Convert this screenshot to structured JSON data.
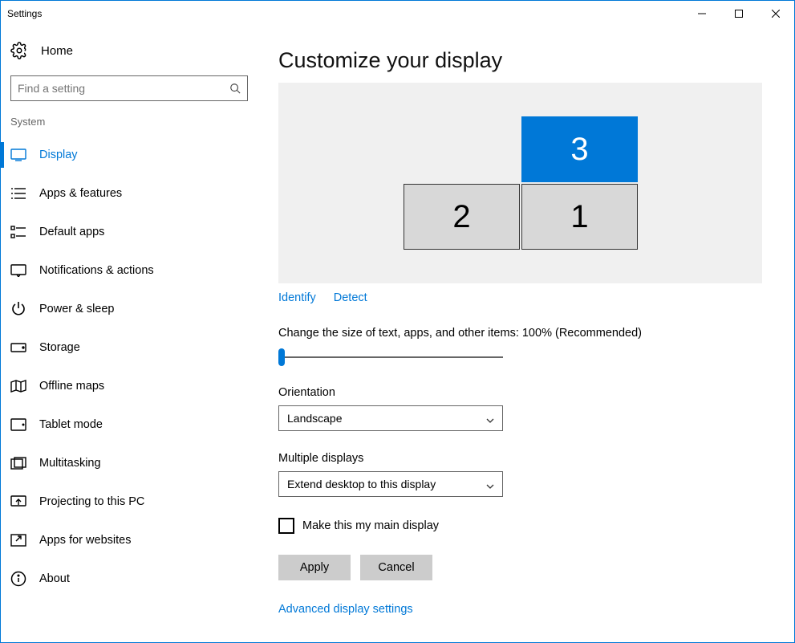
{
  "window": {
    "title": "Settings"
  },
  "sidebar": {
    "home": "Home",
    "search_placeholder": "Find a setting",
    "group": "System",
    "items": [
      "Display",
      "Apps & features",
      "Default apps",
      "Notifications & actions",
      "Power & sleep",
      "Storage",
      "Offline maps",
      "Tablet mode",
      "Multitasking",
      "Projecting to this PC",
      "Apps for websites",
      "About"
    ]
  },
  "main": {
    "heading": "Customize your display",
    "monitors": {
      "m1": "1",
      "m2": "2",
      "m3": "3"
    },
    "identify": "Identify",
    "detect": "Detect",
    "scale_label": "Change the size of text, apps, and other items: 100% (Recommended)",
    "orientation_label": "Orientation",
    "orientation_value": "Landscape",
    "multi_label": "Multiple displays",
    "multi_value": "Extend desktop to this display",
    "make_main": "Make this my main display",
    "apply": "Apply",
    "cancel": "Cancel",
    "advanced": "Advanced display settings"
  }
}
